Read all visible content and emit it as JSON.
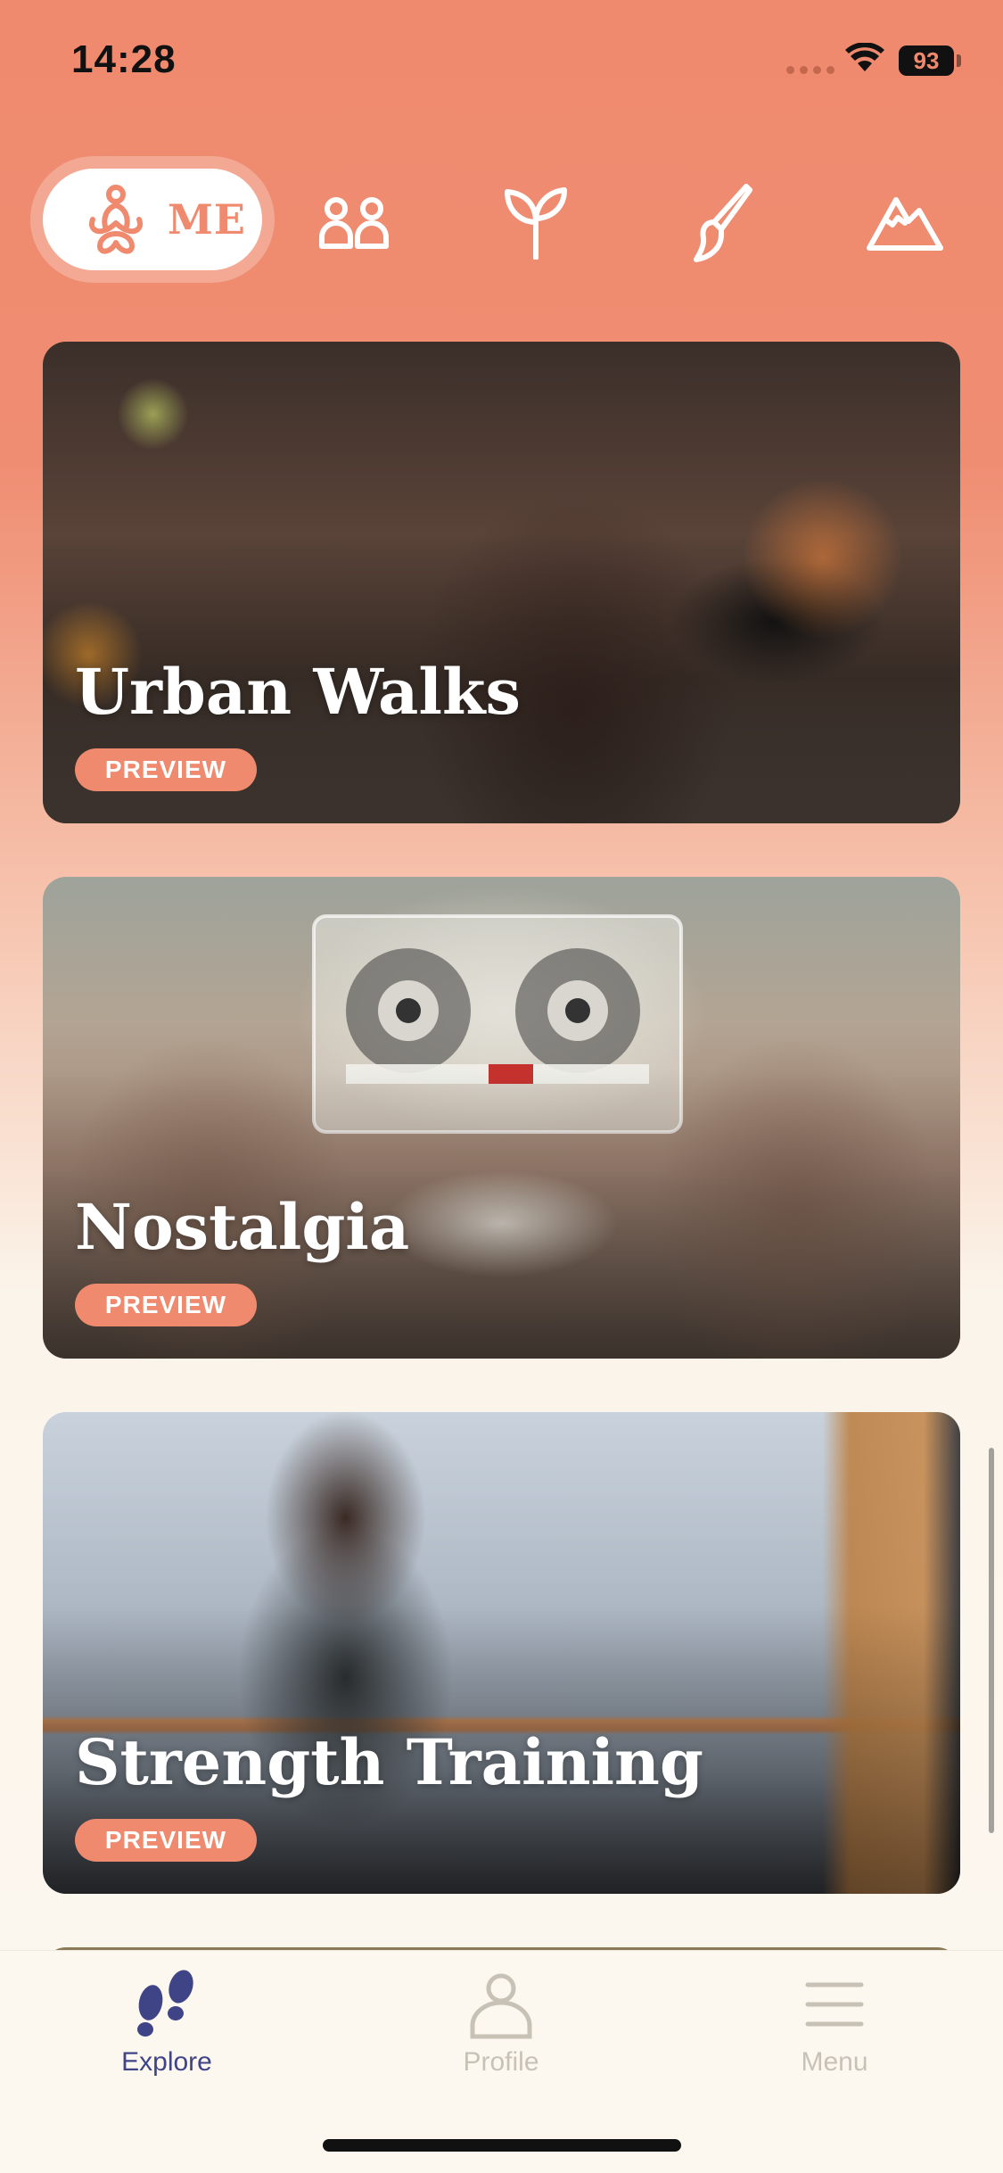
{
  "status_bar": {
    "time": "14:28",
    "battery": "93"
  },
  "tabs": {
    "active_label": "ME",
    "icons": [
      "meditation-icon",
      "people-icon",
      "sprout-icon",
      "brush-icon",
      "mountain-icon"
    ]
  },
  "cards": [
    {
      "title": "Urban Walks",
      "badge": "PREVIEW"
    },
    {
      "title": "Nostalgia",
      "badge": "PREVIEW"
    },
    {
      "title": "Strength Training",
      "badge": "PREVIEW"
    }
  ],
  "bottom_nav": {
    "items": [
      {
        "label": "Explore",
        "icon": "footprints-icon"
      },
      {
        "label": "Profile",
        "icon": "person-icon"
      },
      {
        "label": "Menu",
        "icon": "hamburger-icon"
      }
    ]
  },
  "colors": {
    "accent": "#ef8a6e",
    "nav_active": "#3f4486",
    "nav_inactive": "#c8c1b6"
  }
}
